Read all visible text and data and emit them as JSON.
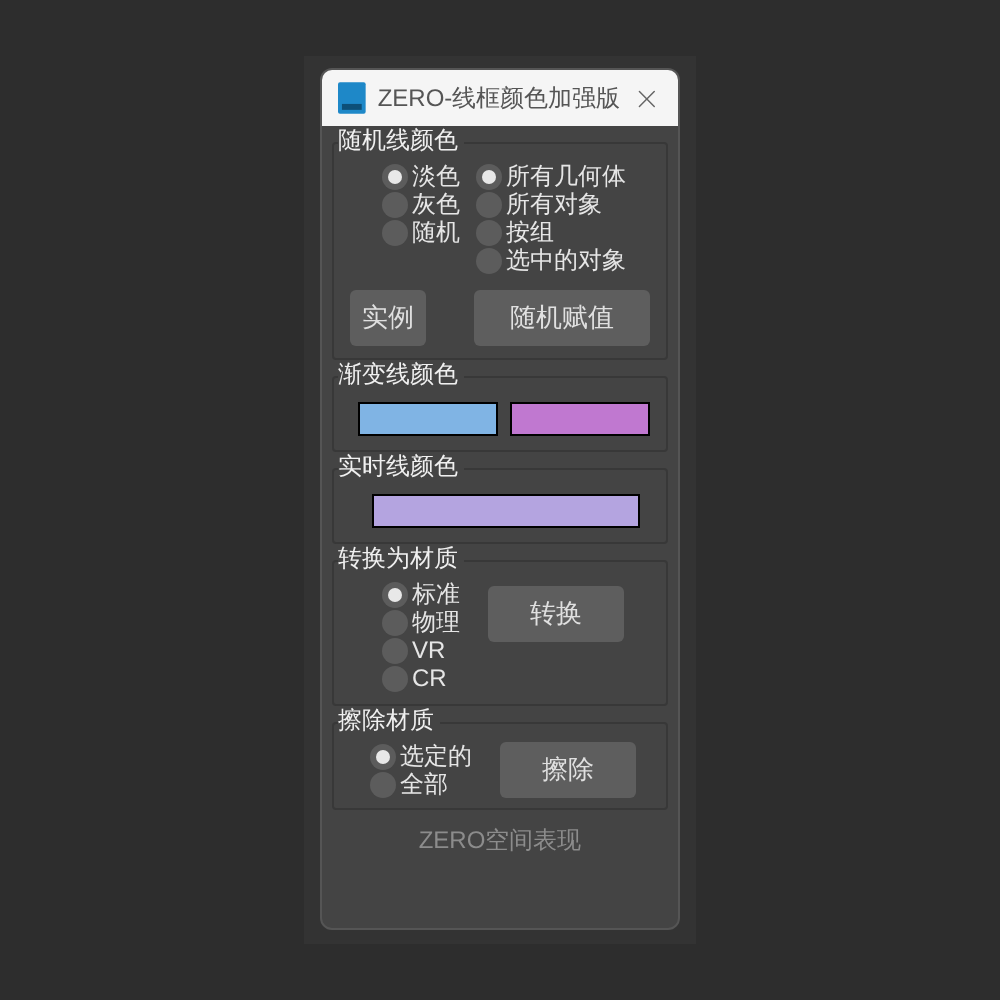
{
  "window": {
    "title": "ZERO-线框颜色加强版"
  },
  "random_line_color": {
    "title": "随机线颜色",
    "color_options": [
      {
        "label": "淡色",
        "selected": true
      },
      {
        "label": "灰色",
        "selected": false
      },
      {
        "label": "随机",
        "selected": false
      }
    ],
    "target_options": [
      {
        "label": "所有几何体",
        "selected": true
      },
      {
        "label": "所有对象",
        "selected": false
      },
      {
        "label": "按组",
        "selected": false
      },
      {
        "label": "选中的对象",
        "selected": false
      }
    ],
    "buttons": [
      "实例",
      "随机赋值"
    ]
  },
  "gradient_line_color": {
    "title": "渐变线颜色",
    "swatches": [
      {
        "color": "#80b4e4"
      },
      {
        "color": "#c078d0"
      }
    ]
  },
  "realtime_line_color": {
    "title": "实时线颜色",
    "swatch": {
      "color": "#b4a4e0"
    }
  },
  "convert_material": {
    "title": "转换为材质",
    "options": [
      {
        "label": "标准",
        "selected": true
      },
      {
        "label": "物理",
        "selected": false
      },
      {
        "label": "VR",
        "selected": false
      },
      {
        "label": "CR",
        "selected": false
      }
    ],
    "button": "转换"
  },
  "erase_material": {
    "title": "擦除材质",
    "options": [
      {
        "label": "选定的",
        "selected": true
      },
      {
        "label": "全部",
        "selected": false
      }
    ],
    "button": "擦除"
  },
  "footer": "ZERO空间表现"
}
